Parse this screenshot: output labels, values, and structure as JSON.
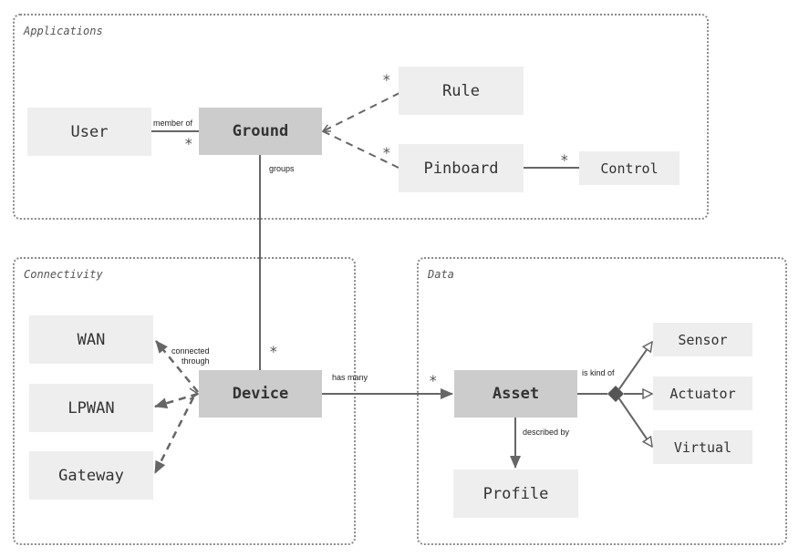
{
  "groups": {
    "applications": "Applications",
    "connectivity": "Connectivity",
    "data": "Data"
  },
  "nodes": {
    "user": "User",
    "ground": "Ground",
    "rule": "Rule",
    "pinboard": "Pinboard",
    "control": "Control",
    "wan": "WAN",
    "lpwan": "LPWAN",
    "gateway": "Gateway",
    "device": "Device",
    "asset": "Asset",
    "profile": "Profile",
    "sensor": "Sensor",
    "actuator": "Actuator",
    "virtual": "Virtual"
  },
  "edges": {
    "member_of": "member of",
    "groups": "groups",
    "connected_through_1": "connected",
    "connected_through_2": "through",
    "has_many": "has many",
    "is_kind_of": "is kind of",
    "described_by": "described by"
  },
  "multiplicity": "*",
  "colors": {
    "node_fill": "#eeeeee",
    "core_fill": "#cccccc",
    "line": "#666666",
    "group_border": "#8a8a8a"
  }
}
